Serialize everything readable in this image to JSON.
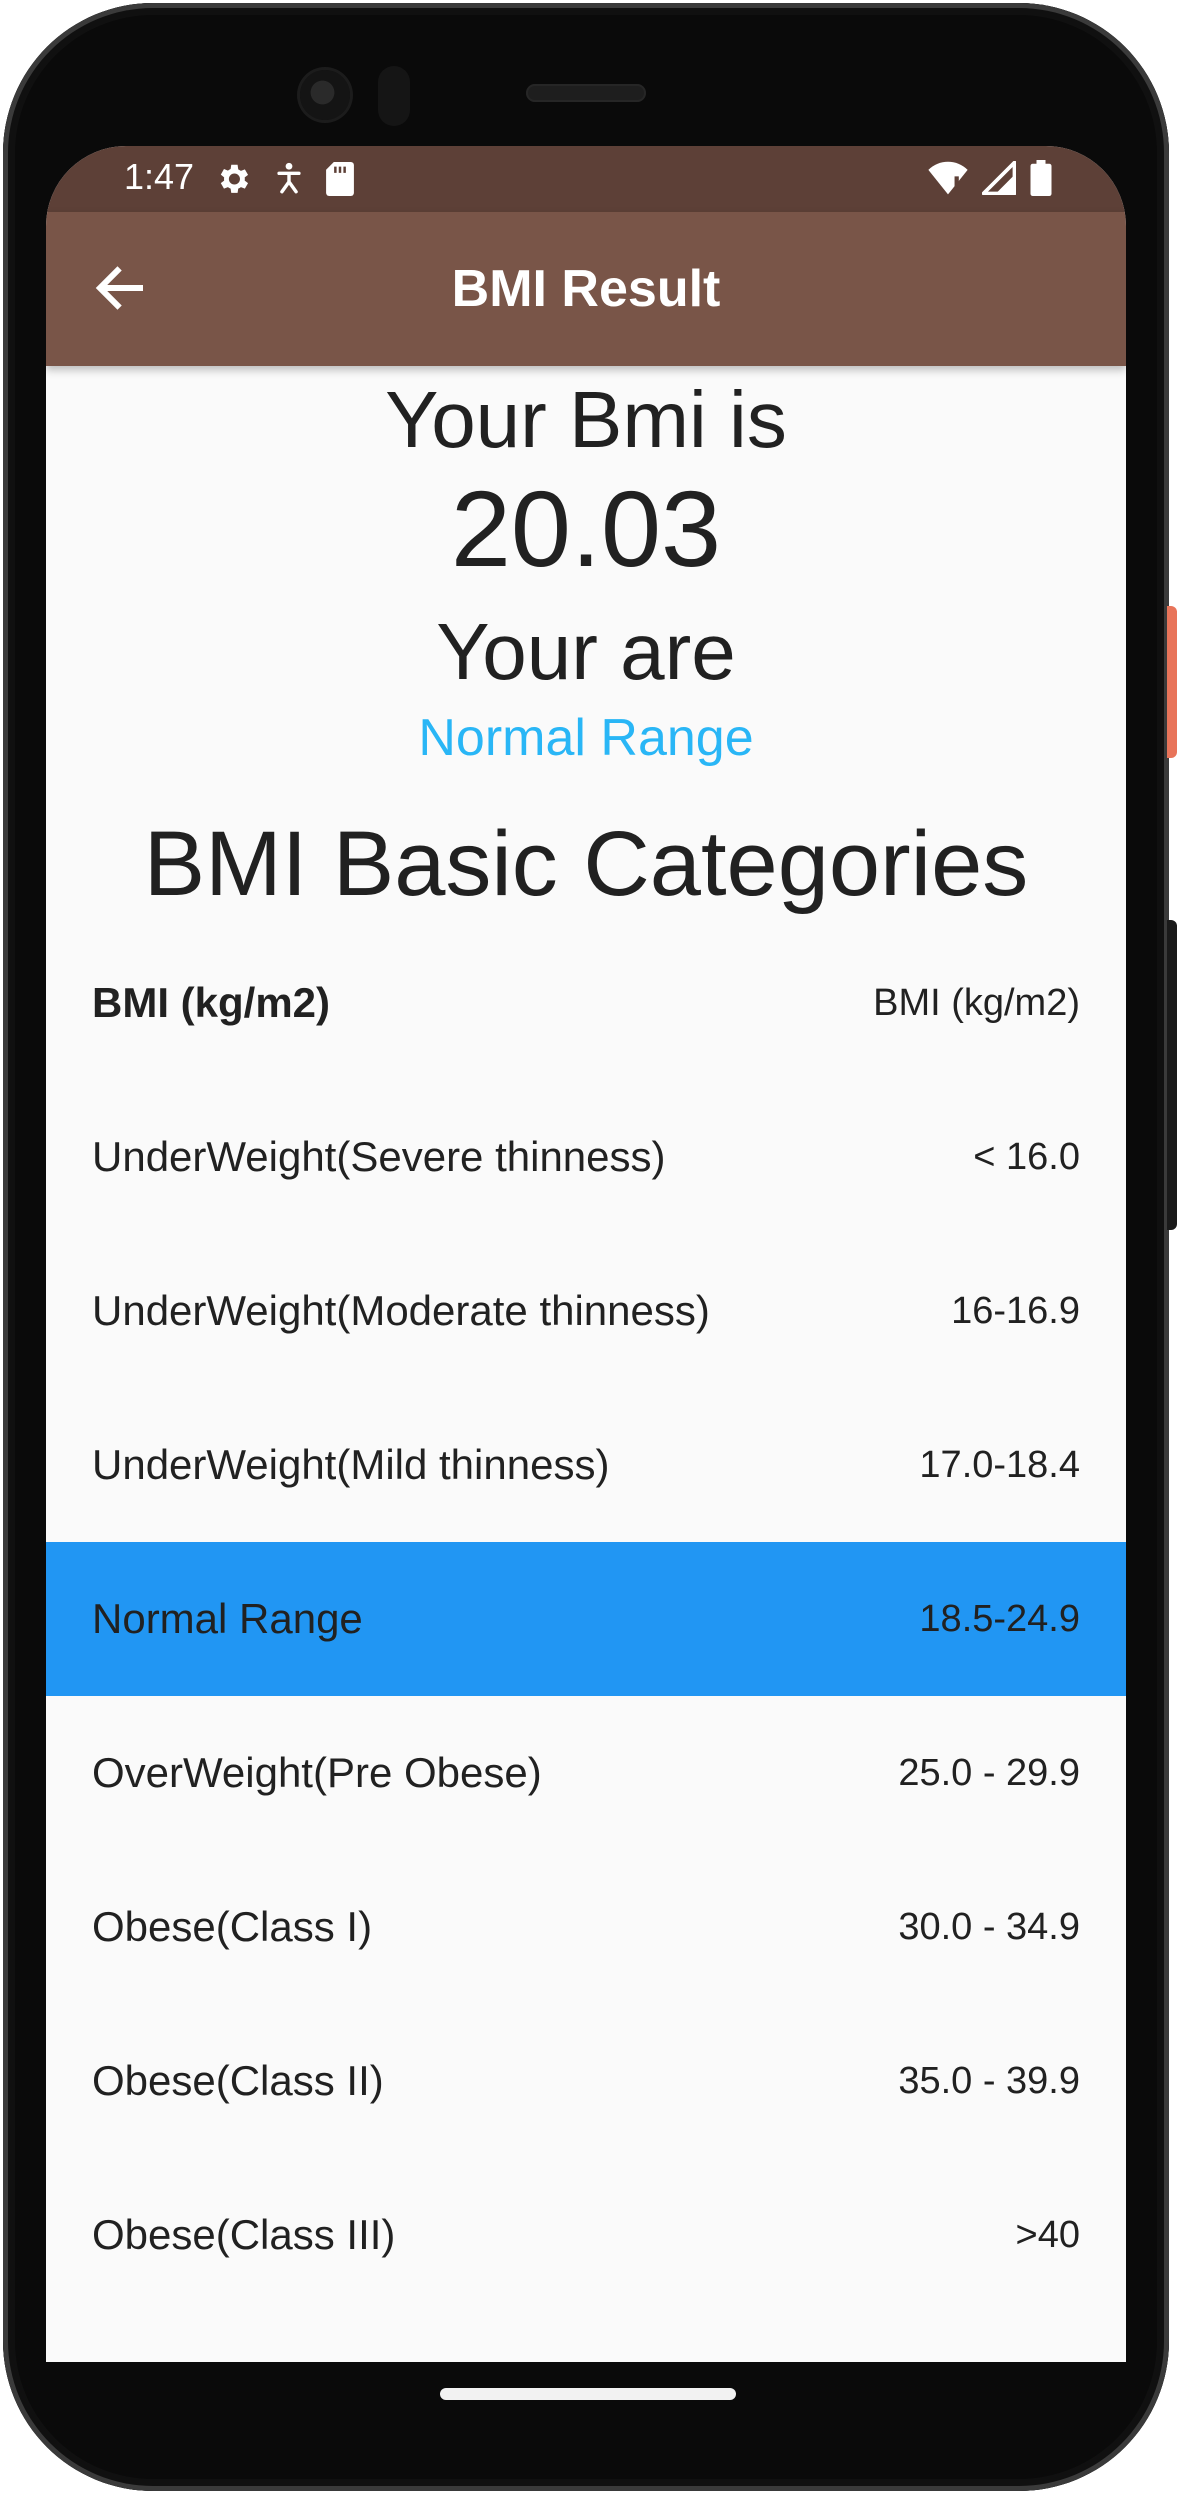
{
  "status_bar": {
    "time": "1:47"
  },
  "app_bar": {
    "title": "BMI Result"
  },
  "result": {
    "label": "Your Bmi is",
    "value": "20.03",
    "you_are": "Your are",
    "range": "Normal Range",
    "range_color": "#29b6f6"
  },
  "categories": {
    "title": "BMI Basic Categories",
    "header": {
      "name": "BMI (kg/m2)",
      "value": "BMI (kg/m2)"
    },
    "rows": [
      {
        "name": "UnderWeight(Severe thinness)",
        "value": "< 16.0"
      },
      {
        "name": "UnderWeight(Moderate thinness)",
        "value": "16-16.9"
      },
      {
        "name": "UnderWeight(Mild thinness)",
        "value": "17.0-18.4"
      },
      {
        "name": "Normal Range",
        "value": "18.5-24.9",
        "highlighted": true
      },
      {
        "name": "OverWeight(Pre Obese)",
        "value": "25.0 - 29.9"
      },
      {
        "name": "Obese(Class I)",
        "value": "30.0 - 34.9"
      },
      {
        "name": "Obese(Class II)",
        "value": "35.0 - 39.9"
      },
      {
        "name": "Obese(Class III)",
        "value": ">40"
      }
    ],
    "highlight_color": "#2196f3"
  },
  "colors": {
    "status_bar": "#5d4037",
    "app_bar": "#795548",
    "background": "#fafafa"
  }
}
